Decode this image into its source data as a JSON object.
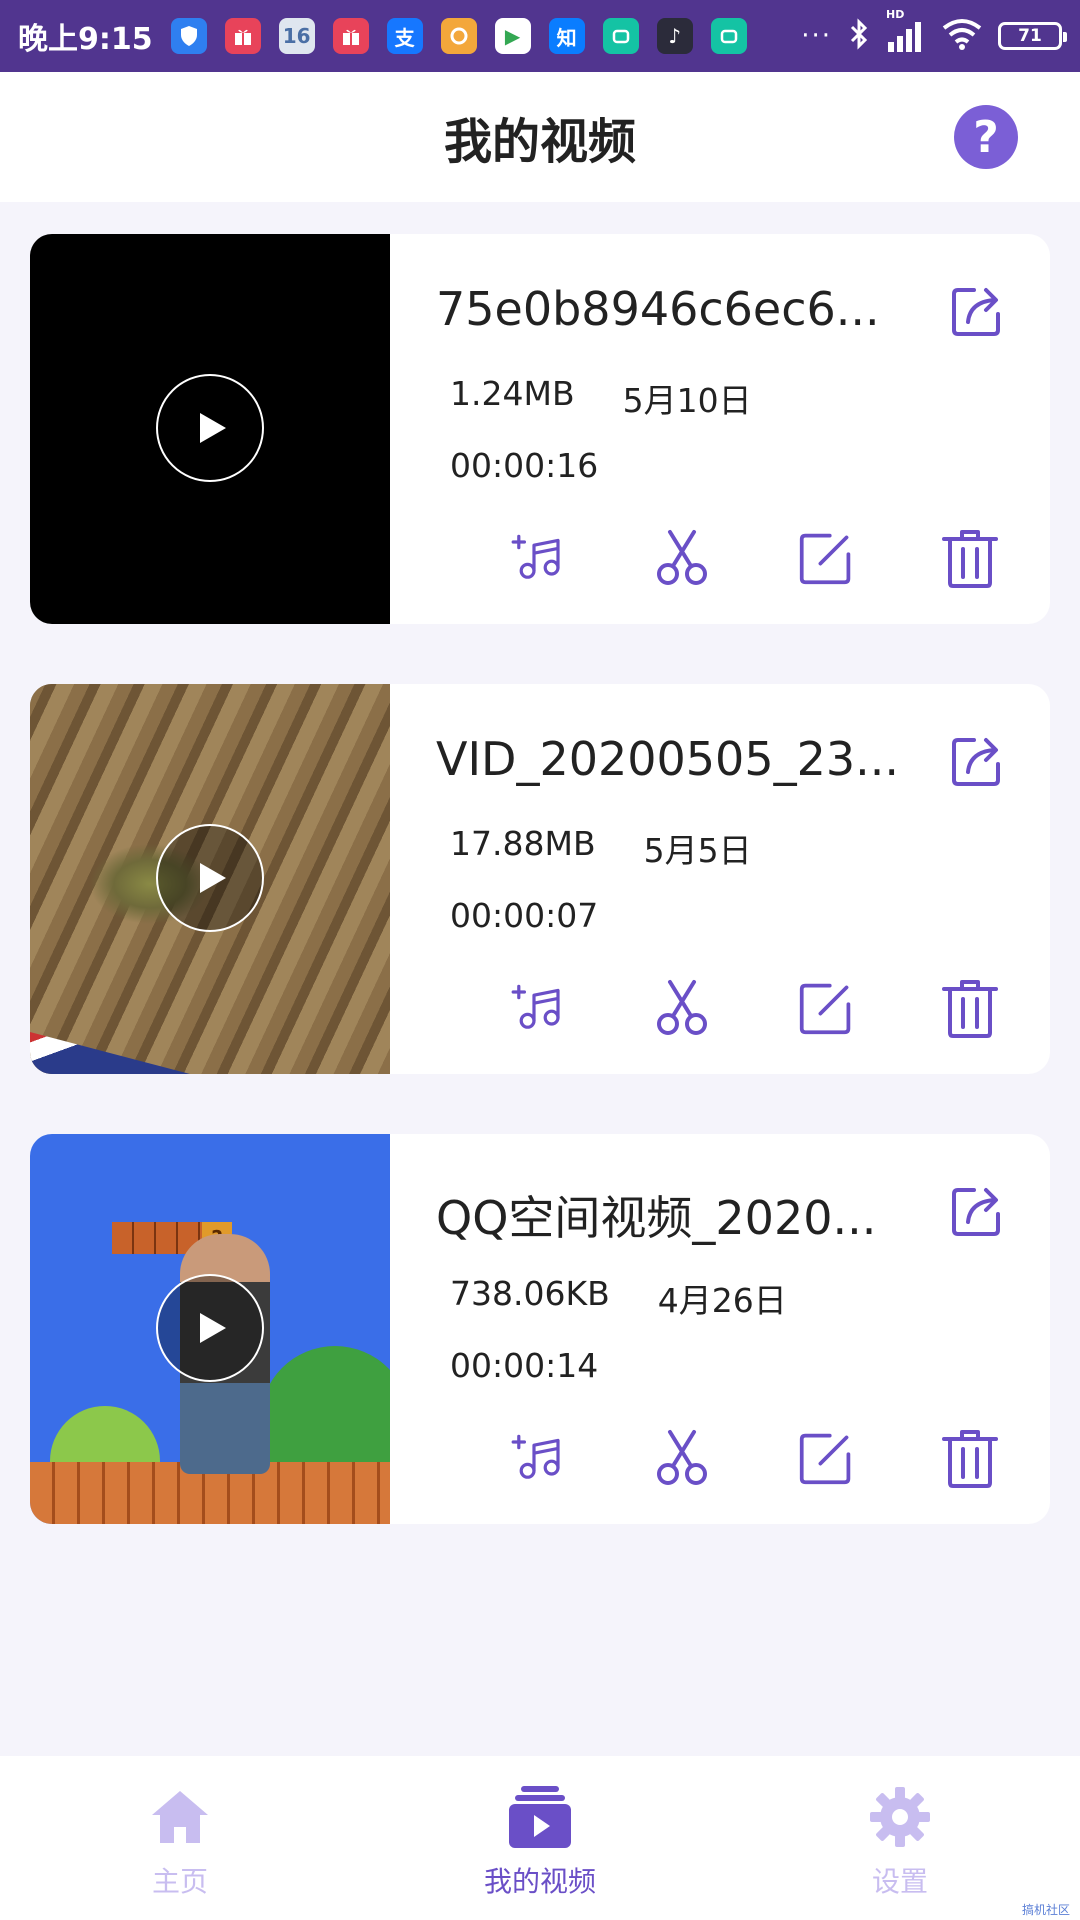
{
  "status_bar": {
    "time": "晚上9:15",
    "apps": [
      {
        "name": "shield-app-icon",
        "label": "",
        "color": "#2f7ff0"
      },
      {
        "name": "gift-app-icon",
        "label": "",
        "color": "#e8435a"
      },
      {
        "name": "calendar-app-icon",
        "label": "16",
        "color": "#dfe6ef"
      },
      {
        "name": "gift-app-icon-2",
        "label": "",
        "color": "#e8435a"
      },
      {
        "name": "alipay-app-icon",
        "label": "支",
        "color": "#1677ff"
      },
      {
        "name": "orange-app-icon",
        "label": "",
        "color": "#f3a73b"
      },
      {
        "name": "play-store-app-icon",
        "label": "▶",
        "color": "#ffffff"
      },
      {
        "name": "zhihu-app-icon",
        "label": "知",
        "color": "#0a7dff"
      },
      {
        "name": "green-app-icon",
        "label": "",
        "color": "#14c3a4"
      },
      {
        "name": "tiktok-app-icon",
        "label": "♪",
        "color": "#2b2b3a"
      },
      {
        "name": "green-app-icon-2",
        "label": "",
        "color": "#14c3a4"
      }
    ],
    "more": "···",
    "battery": "71",
    "network": "HD"
  },
  "header": {
    "title": "我的视频",
    "help_label": "?"
  },
  "videos": [
    {
      "name": "75e0b8946c6ec6...",
      "size": "1.24MB",
      "date": "5月10日",
      "duration": "00:00:16",
      "thumb": "black"
    },
    {
      "name": "VID_20200505_23...",
      "size": "17.88MB",
      "date": "5月5日",
      "duration": "00:00:07",
      "thumb": "cat"
    },
    {
      "name": "QQ空间视频_2020...",
      "size": "738.06KB",
      "date": "4月26日",
      "duration": "00:00:14",
      "thumb": "game"
    }
  ],
  "bottom_nav": {
    "items": [
      {
        "label": "主页",
        "icon": "home-icon",
        "active": false
      },
      {
        "label": "我的视频",
        "icon": "video-library-icon",
        "active": true
      },
      {
        "label": "设置",
        "icon": "gear-icon",
        "active": false
      }
    ]
  },
  "watermark": "搞机社区",
  "colors": {
    "accent": "#6a4fc7",
    "status_bar": "#51358f",
    "inactive_nav": "#c8bdf0",
    "background": "#f5f4fb"
  }
}
